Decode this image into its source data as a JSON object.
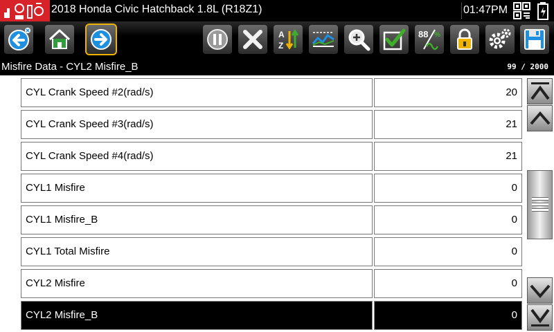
{
  "titlebar": {
    "vehicle": "2018 Honda Civic Hatchback 1.8L (R18Z1)",
    "time": "01:47PM",
    "icons": [
      "vehicle-scan-logo-icon",
      "connection-status-icon",
      "battery-icon"
    ]
  },
  "toolbar": {
    "buttons": [
      {
        "name": "back-button",
        "icon": "back-arrow-icon"
      },
      {
        "name": "home-button",
        "icon": "home-icon"
      },
      {
        "name": "forward-button",
        "icon": "forward-arrow-icon",
        "selected": true
      },
      {
        "name": "pause-button",
        "icon": "pause-icon"
      },
      {
        "name": "clear-button",
        "icon": "close-x-icon"
      },
      {
        "name": "sort-button",
        "icon": "sort-az-icon"
      },
      {
        "name": "graph-button",
        "icon": "graph-icon"
      },
      {
        "name": "zoom-button",
        "icon": "zoom-icon"
      },
      {
        "name": "select-button",
        "icon": "checkmark-icon"
      },
      {
        "name": "units-button",
        "icon": "units-icon"
      },
      {
        "name": "lock-button",
        "icon": "lock-icon"
      },
      {
        "name": "settings-button",
        "icon": "gear-icon"
      },
      {
        "name": "save-button",
        "icon": "floppy-disk-icon"
      }
    ]
  },
  "status": {
    "title": "Misfire Data - CYL2 Misfire_B",
    "page_count": "99 / 2000"
  },
  "rows": [
    {
      "name": "CYL Crank Speed #2(rad/s)",
      "value": "20"
    },
    {
      "name": "CYL Crank Speed #3(rad/s)",
      "value": "21"
    },
    {
      "name": "CYL Crank Speed #4(rad/s)",
      "value": "21"
    },
    {
      "name": "CYL1 Misfire",
      "value": "0"
    },
    {
      "name": "CYL1 Misfire_B",
      "value": "0"
    },
    {
      "name": "CYL1 Total Misfire",
      "value": "0"
    },
    {
      "name": "CYL2 Misfire",
      "value": "0"
    },
    {
      "name": "CYL2 Misfire_B",
      "value": "0",
      "selected": true
    }
  ],
  "scrollbar": {
    "icons": [
      "scroll-top-icon",
      "scroll-up-icon",
      "scroll-thumb-grip",
      "scroll-down-icon",
      "scroll-bottom-icon"
    ]
  },
  "colors": {
    "brand_red": "#d8222a",
    "toolbar_blue": "#1f8fe0",
    "highlight": "#f0b400",
    "check_green": "#3fae2a"
  }
}
